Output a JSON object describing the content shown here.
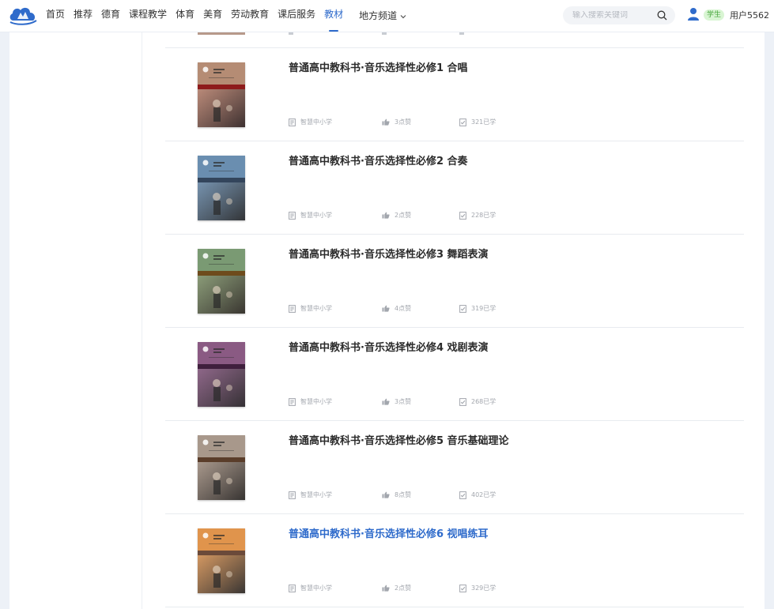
{
  "header": {
    "nav": [
      "首页",
      "推荐",
      "德育",
      "课程教学",
      "体育",
      "美育",
      "劳动教育",
      "课后服务",
      "教材"
    ],
    "active_nav": "教材",
    "local_channel": "地方频道",
    "search_placeholder": "输入搜索关键词",
    "role_badge": "学生",
    "username": "用户5562"
  },
  "colors": {
    "accent": "#2f6bcb",
    "badge_bg": "#d9f5d3",
    "badge_text": "#45a53a"
  },
  "books": [
    {
      "title": "普通高中教科书·音乐选择性必修1 合唱",
      "publisher": "智慧中小学",
      "likes": "3点赞",
      "learners": "321已学",
      "cover_color": "#b58c74",
      "cover_band": "#8e1b1b"
    },
    {
      "title": "普通高中教科书·音乐选择性必修2 合奏",
      "publisher": "智慧中小学",
      "likes": "2点赞",
      "learners": "228已学",
      "cover_color": "#6a8eb0",
      "cover_band": "#33455c"
    },
    {
      "title": "普通高中教科书·音乐选择性必修3 舞蹈表演",
      "publisher": "智慧中小学",
      "likes": "4点赞",
      "learners": "319已学",
      "cover_color": "#7a9a73",
      "cover_band": "#6e4b1c"
    },
    {
      "title": "普通高中教科书·音乐选择性必修4 戏剧表演",
      "publisher": "智慧中小学",
      "likes": "3点赞",
      "learners": "268已学",
      "cover_color": "#8a5a83",
      "cover_band": "#3f1f3d"
    },
    {
      "title": "普通高中教科书·音乐选择性必修5 音乐基础理论",
      "publisher": "智慧中小学",
      "likes": "8点赞",
      "learners": "402已学",
      "cover_color": "#a8988b",
      "cover_band": "#5a3d2a"
    },
    {
      "title": "普通高中教科书·音乐选择性必修6 视唱练耳",
      "publisher": "智慧中小学",
      "likes": "2点赞",
      "learners": "329已学",
      "cover_color": "#e0944c",
      "cover_band": "#6b4a3a"
    }
  ]
}
